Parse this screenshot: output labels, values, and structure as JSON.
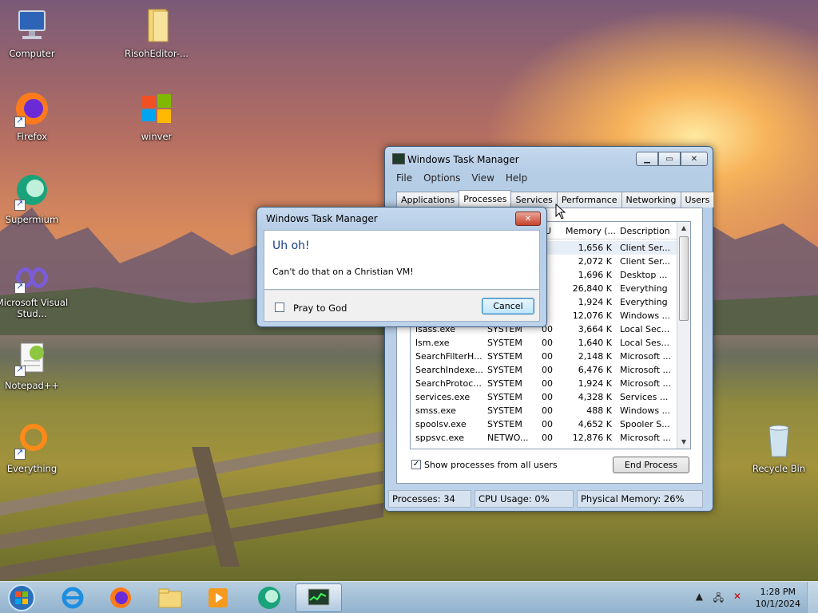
{
  "desktop": {
    "icons": [
      {
        "label": "Computer"
      },
      {
        "label": "RisohEditor-..."
      },
      {
        "label": "Firefox"
      },
      {
        "label": "winver"
      },
      {
        "label": "Supermium"
      },
      {
        "label": "Microsoft Visual Stud..."
      },
      {
        "label": "Notepad++"
      },
      {
        "label": "Everything"
      },
      {
        "label": "Recycle Bin"
      }
    ]
  },
  "task_manager": {
    "title": "Windows Task Manager",
    "menu": [
      "File",
      "Options",
      "View",
      "Help"
    ],
    "tabs": [
      "Applications",
      "Processes",
      "Services",
      "Performance",
      "Networking",
      "Users"
    ],
    "active_tab": "Processes",
    "columns": {
      "c3": "U",
      "c4": "Memory (...",
      "c5": "Description"
    },
    "rows": [
      {
        "name": "",
        "user": "",
        "cpu": "0",
        "mem": "1,656 K",
        "desc": "Client Ser..."
      },
      {
        "name": "",
        "user": "",
        "cpu": "0",
        "mem": "2,072 K",
        "desc": "Client Ser..."
      },
      {
        "name": "",
        "user": "",
        "cpu": "0",
        "mem": "1,696 K",
        "desc": "Desktop ..."
      },
      {
        "name": "",
        "user": "",
        "cpu": "0",
        "mem": "26,840 K",
        "desc": "Everything"
      },
      {
        "name": "",
        "user": "",
        "cpu": "0",
        "mem": "1,924 K",
        "desc": "Everything"
      },
      {
        "name": "",
        "user": "",
        "cpu": "0",
        "mem": "12,076 K",
        "desc": "Windows ..."
      },
      {
        "name": "lsass.exe",
        "user": "SYSTEM",
        "cpu": "00",
        "mem": "3,664 K",
        "desc": "Local Sec..."
      },
      {
        "name": "lsm.exe",
        "user": "SYSTEM",
        "cpu": "00",
        "mem": "1,640 K",
        "desc": "Local Ses..."
      },
      {
        "name": "SearchFilterH...",
        "user": "SYSTEM",
        "cpu": "00",
        "mem": "2,148 K",
        "desc": "Microsoft ..."
      },
      {
        "name": "SearchIndexe...",
        "user": "SYSTEM",
        "cpu": "00",
        "mem": "6,476 K",
        "desc": "Microsoft ..."
      },
      {
        "name": "SearchProtoc...",
        "user": "SYSTEM",
        "cpu": "00",
        "mem": "1,924 K",
        "desc": "Microsoft ..."
      },
      {
        "name": "services.exe",
        "user": "SYSTEM",
        "cpu": "00",
        "mem": "4,328 K",
        "desc": "Services ..."
      },
      {
        "name": "smss.exe",
        "user": "SYSTEM",
        "cpu": "00",
        "mem": "488 K",
        "desc": "Windows ..."
      },
      {
        "name": "spoolsv.exe",
        "user": "SYSTEM",
        "cpu": "00",
        "mem": "4,652 K",
        "desc": "Spooler S..."
      },
      {
        "name": "sppsvc.exe",
        "user": "NETWO...",
        "cpu": "00",
        "mem": "12,876 K",
        "desc": "Microsoft ..."
      }
    ],
    "show_all_label": "Show processes from all users",
    "show_all_checked": true,
    "end_process_label": "End Process",
    "status": {
      "processes": "Processes: 34",
      "cpu": "CPU Usage: 0%",
      "memory": "Physical Memory: 26%"
    }
  },
  "dialog": {
    "title": "Windows Task Manager",
    "heading": "Uh oh!",
    "message": "Can't do that on a Christian VM!",
    "checkbox_label": "Pray to God",
    "cancel_label": "Cancel"
  },
  "taskbar": {
    "time": "1:28 PM",
    "date": "10/1/2024"
  },
  "colors": {
    "accent": "#1b3a8a",
    "close_button": "#c6432e"
  }
}
